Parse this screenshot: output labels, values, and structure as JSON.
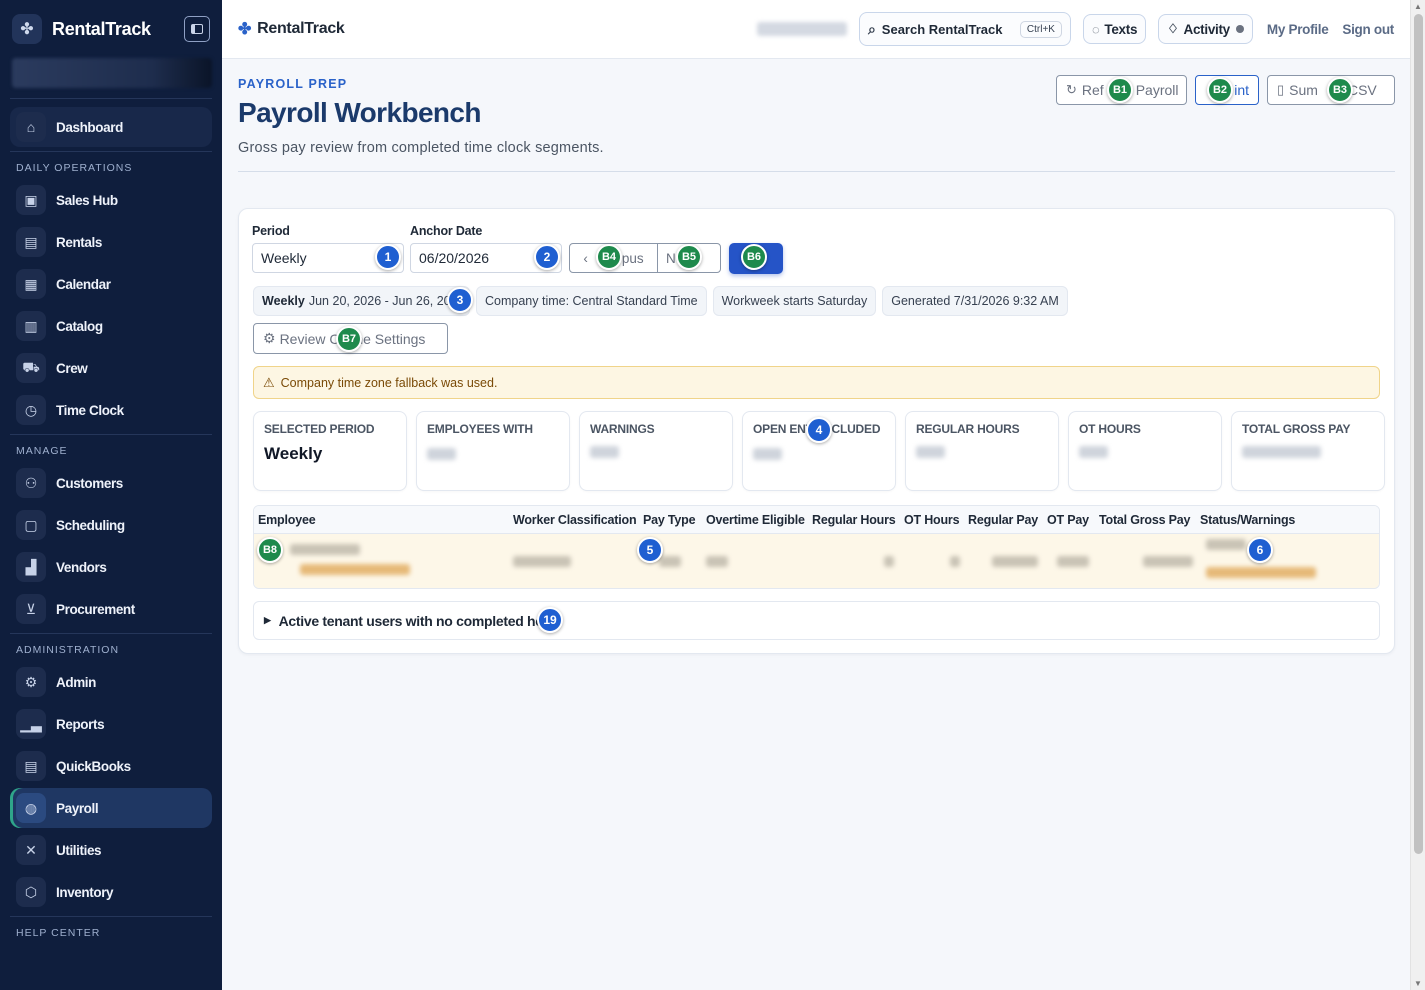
{
  "sidebar": {
    "brand": "RentalTrack",
    "items_top": [
      {
        "label": "Dashboard",
        "icon": "home-icon"
      }
    ],
    "sections": [
      {
        "title": "DAILY OPERATIONS",
        "items": [
          {
            "label": "Sales Hub",
            "icon": "user-card-icon"
          },
          {
            "label": "Rentals",
            "icon": "rentals-icon"
          },
          {
            "label": "Calendar",
            "icon": "calendar-icon"
          },
          {
            "label": "Catalog",
            "icon": "catalog-icon"
          },
          {
            "label": "Crew",
            "icon": "truck-icon"
          },
          {
            "label": "Time Clock",
            "icon": "stopwatch-icon"
          }
        ]
      },
      {
        "title": "MANAGE",
        "items": [
          {
            "label": "Customers",
            "icon": "users-icon"
          },
          {
            "label": "Scheduling",
            "icon": "schedule-icon"
          },
          {
            "label": "Vendors",
            "icon": "building-icon"
          },
          {
            "label": "Procurement",
            "icon": "cart-icon"
          }
        ]
      },
      {
        "title": "ADMINISTRATION",
        "items": [
          {
            "label": "Admin",
            "icon": "gear-icon"
          },
          {
            "label": "Reports",
            "icon": "bar-chart-icon"
          },
          {
            "label": "QuickBooks",
            "icon": "ledger-icon"
          },
          {
            "label": "Payroll",
            "icon": "payroll-icon"
          },
          {
            "label": "Utilities",
            "icon": "tools-icon"
          },
          {
            "label": "Inventory",
            "icon": "box-icon"
          }
        ]
      },
      {
        "title": "HELP CENTER",
        "items": []
      }
    ]
  },
  "topbar": {
    "brand": "RentalTrack",
    "search_label": "Search RentalTrack",
    "search_shortcut": "Ctrl+K",
    "texts_label": "Texts",
    "activity_label": "Activity",
    "profile_label": "My Profile",
    "signout_label": "Sign out"
  },
  "header": {
    "eyebrow": "PAYROLL PREP",
    "title": "Payroll Workbench",
    "subtitle": "Gross pay review from completed time clock segments.",
    "actions": [
      {
        "label_before": "Ref",
        "label_after": "Payroll",
        "icon": "refresh-icon",
        "marker": "B1"
      },
      {
        "label_before": "",
        "label_after": "int",
        "icon": "",
        "marker": "B2"
      },
      {
        "label_before": "Sum",
        "label_after": "CSV",
        "icon": "document-icon",
        "marker": "B3"
      }
    ]
  },
  "filters": {
    "period_label": "Period",
    "period_value": "Weekly",
    "anchor_label": "Anchor Date",
    "anchor_value": "06/20/2026",
    "prev_label": "pus",
    "next_label": "N",
    "chips": [
      {
        "bold": "Weekly",
        "text": "Jun 20, 2026 - Jun 26, 20"
      },
      {
        "bold": "",
        "text": "Company time: Central Standard Time"
      },
      {
        "bold": "",
        "text": "Workweek starts Saturday"
      },
      {
        "bold": "",
        "text": "Generated 7/31/2026 9:32 AM"
      }
    ],
    "review_before": "Review C",
    "review_after": "me Settings"
  },
  "warning": "Company time zone fallback was used.",
  "stats": [
    {
      "label": "SELECTED PERIOD",
      "value": "Weekly"
    },
    {
      "label": "EMPLOYEES WITH HOURS",
      "value": ""
    },
    {
      "label": "WARNINGS",
      "value": ""
    },
    {
      "label": "OPEN ENT EXCLUDED",
      "value": ""
    },
    {
      "label": "REGULAR HOURS",
      "value": ""
    },
    {
      "label": "OT HOURS",
      "value": ""
    },
    {
      "label": "TOTAL GROSS PAY",
      "value": ""
    }
  ],
  "table": {
    "columns": [
      "Employee",
      "Worker Classification",
      "Pay Type",
      "Overtime Eligible",
      "Regular Hours",
      "OT Hours",
      "Regular Pay",
      "OT Pay",
      "Total Gross Pay",
      "Status/Warnings"
    ]
  },
  "accordion": "Active tenant users with no completed hou",
  "markers": {
    "blue": [
      "1",
      "2",
      "3",
      "4",
      "5",
      "6",
      "19"
    ],
    "green": [
      "B1",
      "B2",
      "B3",
      "B4",
      "B5",
      "B6",
      "B7",
      "B8"
    ]
  },
  "colors": {
    "sidebar_bg": "#0f1e3d",
    "accent_blue": "#2a62c9",
    "title_navy": "#1b3a6b",
    "warning_bg": "#fdf6e3",
    "marker_blue": "#1f5fd1",
    "marker_green": "#1e8a4c"
  }
}
